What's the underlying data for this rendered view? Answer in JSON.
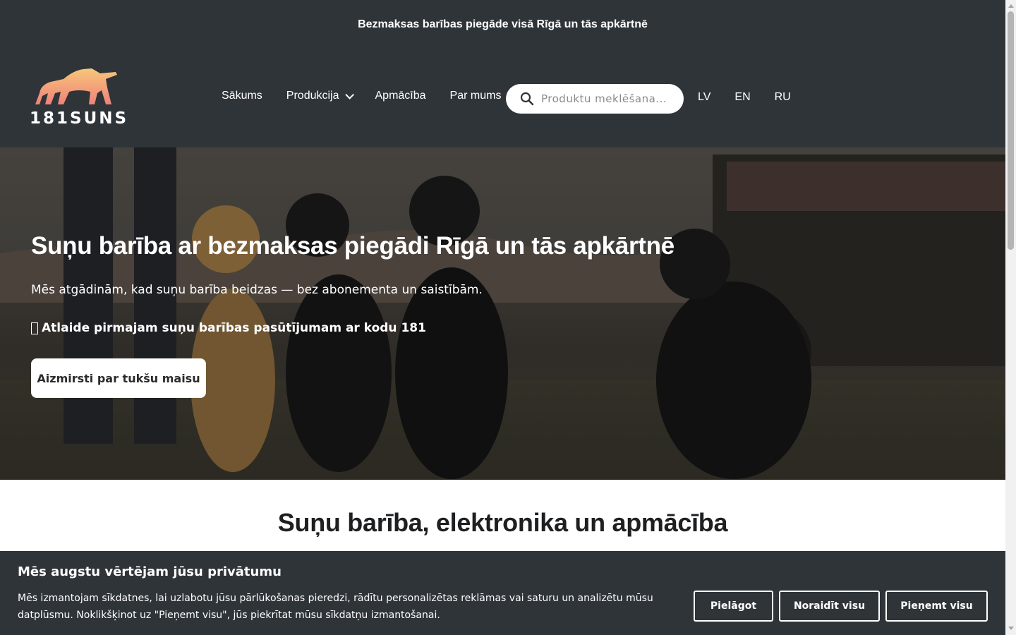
{
  "topbar": {
    "text": "Bezmaksas barības piegāde visā Rīgā un tās apkārtnē"
  },
  "logo": {
    "text": "181SUNS",
    "icon": "dog-logo-icon",
    "gradient": [
      "#f7c77a",
      "#f0827a"
    ]
  },
  "nav": {
    "items": [
      {
        "label": "Sākums"
      },
      {
        "label": "Produkcija",
        "has_dropdown": true
      },
      {
        "label": "Apmācība"
      },
      {
        "label": "Par mums"
      }
    ]
  },
  "search": {
    "placeholder": "Produktu meklēšana...",
    "value": "",
    "icon": "search-icon"
  },
  "languages": [
    "LV",
    "EN",
    "RU"
  ],
  "hero": {
    "title": "Suņu barība ar bezmaksas piegādi Rīgā un tās apkārtnē",
    "subtitle": "Mēs atgādinām, kad suņu barība beidzas — bez abonementa un saistībām.",
    "promo": "Atlaide pirmajam suņu barības pasūtījumam ar kodu 181",
    "promo_icon": "missing-glyph-icon",
    "button": "Aizmirsti par tukšu maisu"
  },
  "section": {
    "title": "Suņu barība, elektronika un apmācība"
  },
  "cookie": {
    "title": "Mēs augstu vērtējam jūsu privātumu",
    "text": "Mēs izmantojam sīkdatnes, lai uzlabotu jūsu pārlūkošanas pieredzi, rādītu personalizētas reklāmas vai saturu un analizētu mūsu datplūsmu. Noklikšķinot uz \"Pieņemt visu\", jūs piekrītat mūsu sīkdatņu izmantošanai.",
    "buttons": {
      "customize": "Pielāgot",
      "reject": "Noraidīt visu",
      "accept": "Pieņemt visu"
    }
  },
  "colors": {
    "header_bg": "#2f3439",
    "text_on_dark": "#ffffff",
    "heading_dark": "#1e1f21"
  }
}
